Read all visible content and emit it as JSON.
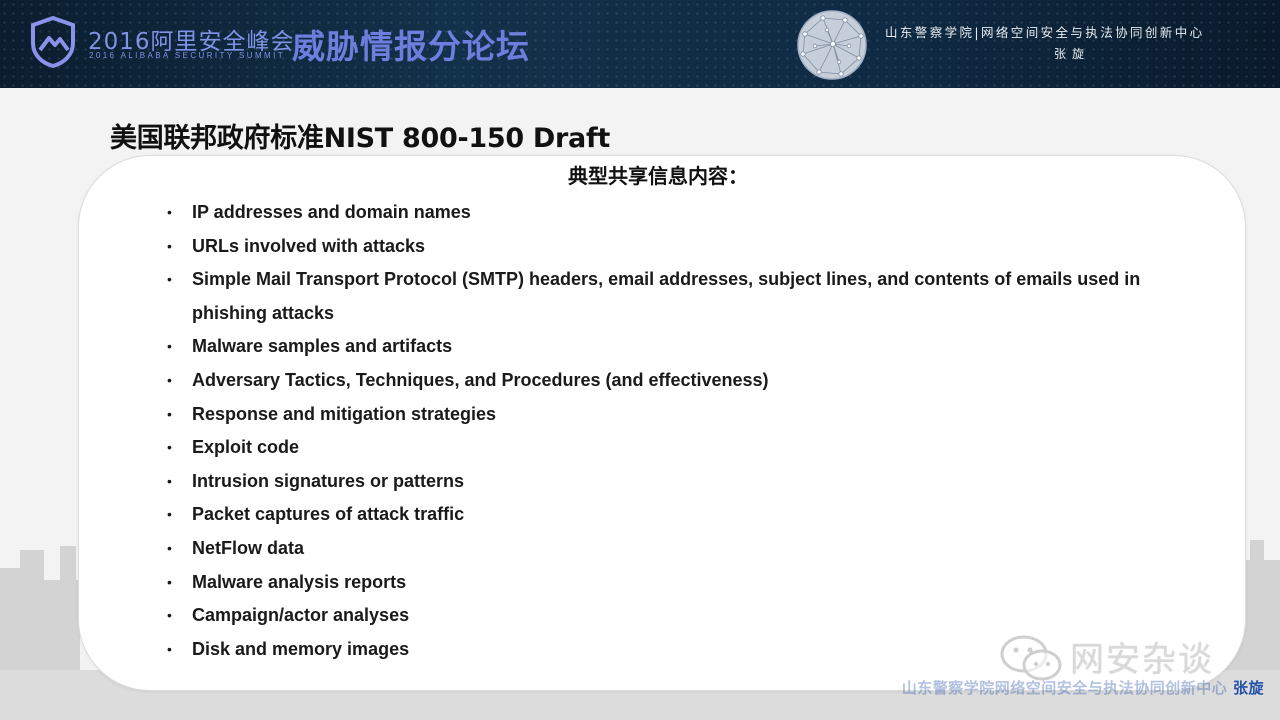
{
  "banner": {
    "summit_title": "2016阿里安全峰会",
    "summit_subtitle": "2016 ALIBABA SECURITY SUMMIT",
    "forum_title": "威胁情报分论坛",
    "organization": "山东警察学院|网络空间安全与执法协同创新中心",
    "presenter": "张旋"
  },
  "slide": {
    "title": "美国联邦政府标准NIST 800-150 Draft",
    "heading": "典型共享信息内容：",
    "bullet_symbol": "•",
    "items": [
      "IP addresses and domain names",
      "URLs involved with attacks",
      "Simple Mail Transport Protocol (SMTP) headers, email addresses, subject lines, and contents of emails used in phishing attacks",
      "Malware samples and artifacts",
      "Adversary Tactics, Techniques, and Procedures (and effectiveness)",
      "Response and mitigation strategies",
      "Exploit code",
      "Intrusion signatures or patterns",
      "Packet captures of attack traffic",
      "NetFlow data",
      "Malware analysis reports",
      "Campaign/actor analyses",
      "Disk and memory images"
    ]
  },
  "watermark": {
    "footer_org": "山东警察学院网络空间安全与执法协同创新中心",
    "footer_name": "张旋",
    "channel": "网安杂谈"
  },
  "colors": {
    "banner_bg": "#0f2a42",
    "summit_blue": "#7f93e6",
    "footer_blue": "#2452a8"
  },
  "icons": [
    "shield-logo-icon",
    "globe-network-icon",
    "wechat-icon"
  ]
}
